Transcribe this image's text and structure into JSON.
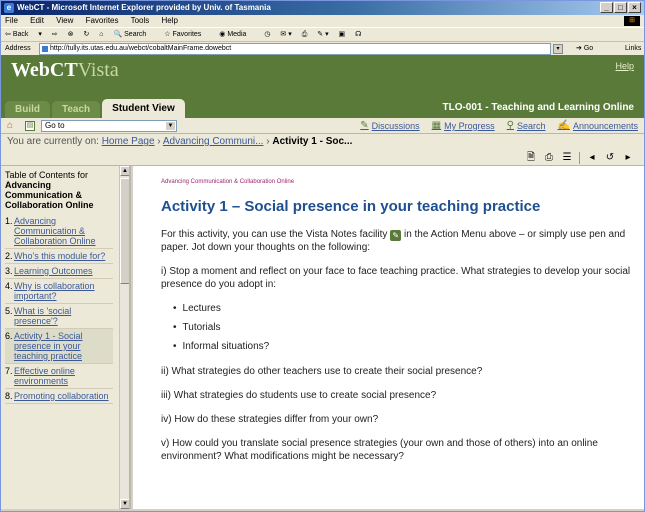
{
  "window": {
    "title": "WebCT - Microsoft Internet Explorer provided by Univ. of Tasmania"
  },
  "menu": [
    "File",
    "Edit",
    "View",
    "Favorites",
    "Tools",
    "Help"
  ],
  "toolbar": {
    "back": "Back",
    "search": "Search",
    "favorites": "Favorites",
    "media": "Media"
  },
  "address": {
    "label": "Address",
    "url": "http://tully.its.utas.edu.au/webct/cobaltMainFrame.dowebct",
    "go": "Go",
    "links": "Links"
  },
  "header": {
    "brand_main": "WebCT",
    "brand_sub": "Vista",
    "help": "Help",
    "tabs": [
      {
        "label": "Build",
        "active": false
      },
      {
        "label": "Teach",
        "active": false
      },
      {
        "label": "Student View",
        "active": true
      }
    ],
    "course": "TLO-001 - Teaching and Learning Online"
  },
  "nav": {
    "goto_value": "Go to",
    "links": [
      "Discussions",
      "My Progress",
      "Search",
      "Announcements"
    ]
  },
  "breadcrumb": {
    "prefix": "You are currently on:",
    "home": "Home Page",
    "section": "Advancing Communi...",
    "current": "Activity 1 - Soc..."
  },
  "toc": {
    "heading": "Table of Contents for",
    "course": "Advancing Communication & Collaboration Online",
    "items": [
      {
        "num": "1.",
        "label": "Advancing Communication & Collaboration Online"
      },
      {
        "num": "2.",
        "label": "Who's this module for?"
      },
      {
        "num": "3.",
        "label": "Learning Outcomes"
      },
      {
        "num": "4.",
        "label": "Why is collaboration important?"
      },
      {
        "num": "5.",
        "label": "What is 'social presence'?"
      },
      {
        "num": "6.",
        "label": "Activity 1 - Social presence in your teaching practice"
      },
      {
        "num": "7.",
        "label": "Effective online environments"
      },
      {
        "num": "8.",
        "label": "Promoting collaboration"
      }
    ]
  },
  "content": {
    "course_crumb": "Advancing Communication & Collaboration Online",
    "title": "Activity 1 – Social presence in your teaching practice",
    "intro_a": "For this activity, you can use the Vista Notes facility",
    "intro_b": "in the Action Menu above – or simply use pen and paper. Jot down your thoughts on the following:",
    "q1": "i) Stop a moment and reflect on your face to face teaching practice. What strategies to develop your social presence do you adopt in:",
    "bullets": [
      "Lectures",
      "Tutorials",
      "Informal situations?"
    ],
    "q2": "ii) What strategies do other teachers use to create their social presence?",
    "q3": "iii) What strategies do students use to create social presence?",
    "q4": "iv) How do these strategies differ from your own?",
    "q5": "v) How could you translate social presence strategies (your own and those of others) into an online environment? What modifications might be necessary?"
  },
  "colors": {
    "header_green": "#5a7a3a",
    "title_blue": "#1f4f8f",
    "link_blue": "#3b5998",
    "crumb_magenta": "#a0266e"
  }
}
